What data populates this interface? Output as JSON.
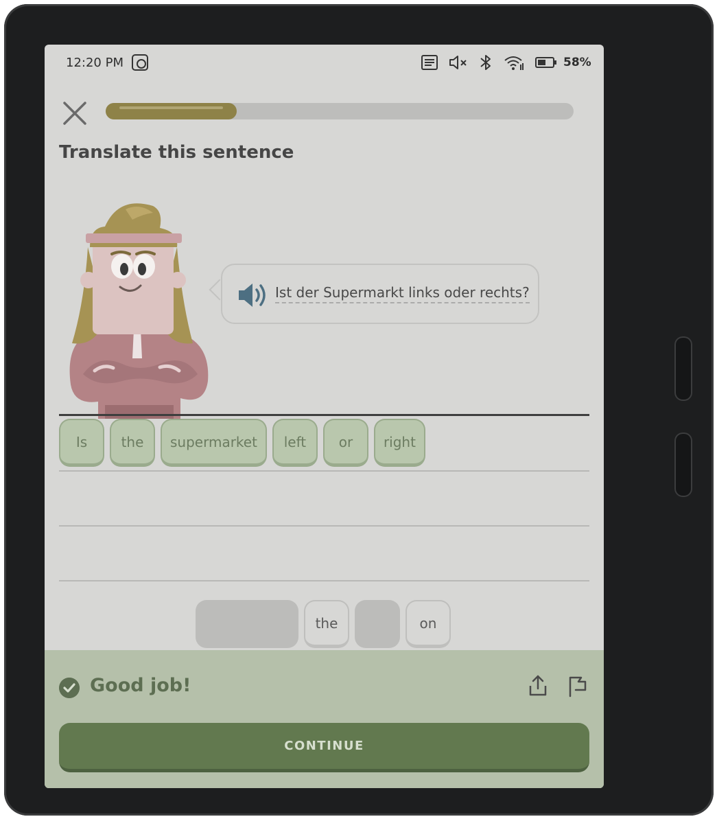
{
  "status_bar": {
    "time": "12:20 PM",
    "battery": "58%",
    "icons": [
      "app-icon",
      "reader-icon",
      "mute-icon",
      "bluetooth-icon",
      "wifi-icon",
      "battery-icon"
    ]
  },
  "header": {
    "progress": 0.28,
    "instruction": "Translate this sentence"
  },
  "prompt": {
    "sentence": "Ist der Supermarkt links oder rechts?"
  },
  "answer": {
    "tiles": [
      {
        "text": "Is"
      },
      {
        "text": "the"
      },
      {
        "text": "supermarket"
      },
      {
        "text": "left"
      },
      {
        "text": "or"
      },
      {
        "text": "right"
      }
    ]
  },
  "word_bank": {
    "tiles": [
      {
        "text": "the"
      },
      {
        "text": "on"
      }
    ]
  },
  "feedback": {
    "title": "Good job!",
    "continue_label": "CONTINUE"
  },
  "colors": {
    "progress": "#8e8248",
    "tile_selected": "#b9c7ad",
    "feedback_bg": "#b5c0aa",
    "continue_button": "#62794f"
  }
}
